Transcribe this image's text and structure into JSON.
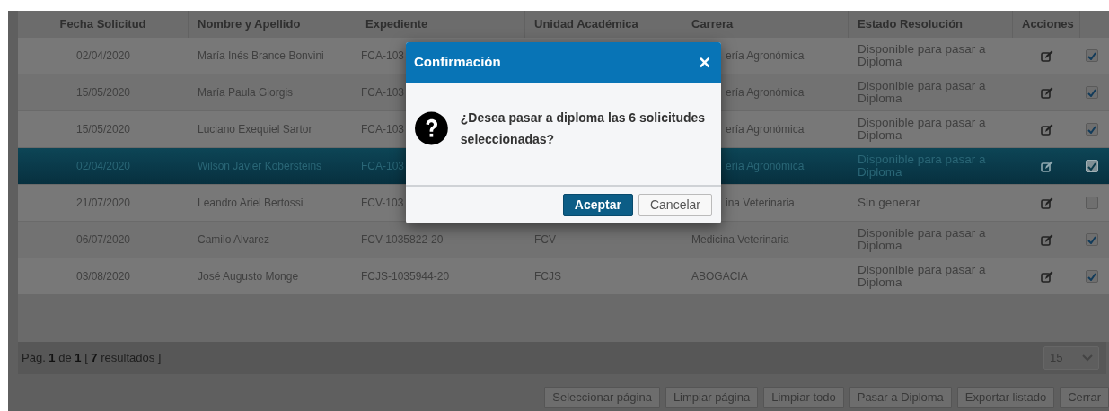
{
  "table": {
    "columns": [
      "Fecha Solicitud",
      "Nombre y Apellido",
      "Expediente",
      "Unidad Académica",
      "Carrera",
      "Estado Resolución",
      "Acciones"
    ],
    "rows": [
      {
        "fecha": "02/04/2020",
        "nombre": "María Inés Brance Bonvini",
        "expediente": "FCA-103",
        "carrera": "ería Agronómica",
        "carrera_cut": true,
        "estado": "Disponible para pasar a Diploma",
        "checked": true,
        "selected": false
      },
      {
        "fecha": "15/05/2020",
        "nombre": "María Paula Giorgis",
        "expediente": "FCA-103",
        "carrera": "ería Agronómica",
        "carrera_cut": true,
        "estado": "Disponible para pasar a Diploma",
        "checked": true,
        "selected": false
      },
      {
        "fecha": "15/05/2020",
        "nombre": "Luciano Exequiel Sartor",
        "expediente": "FCA-103",
        "carrera": "ería Agronómica",
        "carrera_cut": true,
        "estado": "Disponible para pasar a Diploma",
        "checked": true,
        "selected": false
      },
      {
        "fecha": "02/04/2020",
        "nombre": "Wilson Javier Kobersteins",
        "expediente": "FCA-103",
        "carrera": "ería Agronómica",
        "carrera_cut": true,
        "estado": "Disponible para pasar a Diploma",
        "checked": true,
        "selected": true
      },
      {
        "fecha": "21/07/2020",
        "nombre": "Leandro Ariel Bertossi",
        "expediente": "FCV-103",
        "carrera": "ina Veterinaria",
        "carrera_cut": true,
        "estado": "Sin generar",
        "checked": false,
        "selected": false
      },
      {
        "fecha": "06/07/2020",
        "nombre": "Camilo Alvarez",
        "expediente": "FCV-1035822-20",
        "unidad": "FCV",
        "carrera": "Medicina Veterinaria",
        "carrera_cut": false,
        "estado": "Disponible para pasar a Diploma",
        "checked": true,
        "selected": false
      },
      {
        "fecha": "03/08/2020",
        "nombre": "José Augusto Monge",
        "expediente": "FCJS-1035944-20",
        "unidad": "FCJS",
        "carrera": "ABOGACIA",
        "carrera_cut": false,
        "estado": "Disponible para pasar a Diploma",
        "checked": true,
        "selected": false
      }
    ]
  },
  "pager": {
    "text": "Pág. **1** de **1** [ **7** resultados ]",
    "page_size": "15"
  },
  "buttons": [
    "Seleccionar página",
    "Limpiar página",
    "Limpiar todo",
    "Pasar a Diploma",
    "Exportar listado",
    "Cerrar"
  ],
  "dialog": {
    "title": "Confirmación",
    "close": "×",
    "message": "¿Desea pasar a diploma las 6 solicitudes seleccionadas?",
    "buttons": [
      {
        "label": "Aceptar",
        "kind": "primary"
      },
      {
        "label": "Cancelar",
        "kind": "secondary"
      }
    ]
  }
}
